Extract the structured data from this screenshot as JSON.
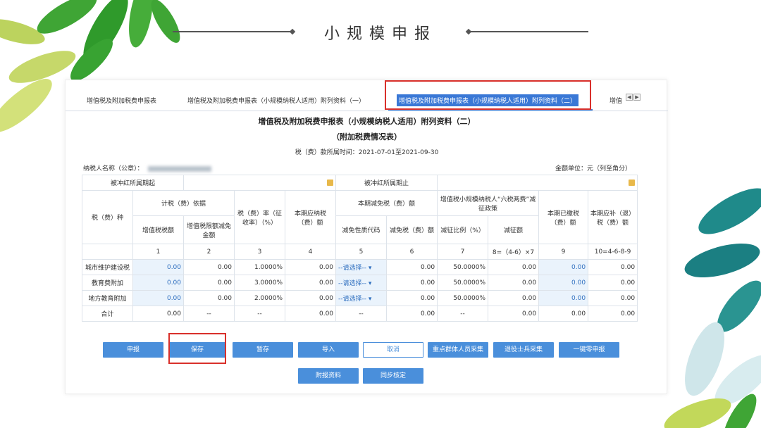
{
  "slide": {
    "title": "小规模申报"
  },
  "tabs": [
    {
      "label": "增值税及附加税费申报表"
    },
    {
      "label": "增值税及附加税费申报表（小规模纳税人适用）附列资料（一）"
    },
    {
      "label": "增值税及附加税费申报表（小规模纳税人适用）附列资料（二）"
    },
    {
      "label": "增值"
    }
  ],
  "form": {
    "title": "增值税及附加税费申报表（小规模纳税人适用）附列资料（二）",
    "subtitle": "（附加税费情况表）",
    "period": "税（费）款所属时间：2021-07-01至2021-09-30",
    "taxpayer_label": "纳税人名称（公章）：",
    "unit": "金额单位：元（列至角分）",
    "offset_start_label": "被冲红所属期起",
    "offset_end_label": "被冲红所属期止"
  },
  "table": {
    "h_tax_type": "税（费）种",
    "h_basis": "计税（费）依据",
    "h_rate": "税（费）率（征收率）（%）",
    "h_payable": "本期应纳税（费）额",
    "h_reduction": "本期减免税（费）额",
    "h_six_taxes": "增值税小规模纳税人“六税两费”减征政策",
    "h_paid": "本期已缴税（费）额",
    "h_due": "本期应补（退）税（费）额",
    "h_vat": "增值税税额",
    "h_vat_limit": "增值税限额减免金额",
    "h_nature_code": "减免性质代码",
    "h_reduction_amt": "减免税（费）额",
    "h_ratio": "减征比例（%）",
    "h_cut_amt": "减征额",
    "col_nums": [
      "1",
      "2",
      "3",
      "4",
      "5",
      "6",
      "7",
      "8=（4-6）×7",
      "9",
      "10=4-6-8-9"
    ],
    "rows": [
      {
        "name": "城市维护建设税",
        "c1": "0.00",
        "c2": "0.00",
        "c3": "1.0000%",
        "c4": "0.00",
        "c5": "--请选择--",
        "c6": "0.00",
        "c7": "50.0000%",
        "c8": "0.00",
        "c9": "0.00",
        "c10": "0.00"
      },
      {
        "name": "教育费附加",
        "c1": "0.00",
        "c2": "0.00",
        "c3": "3.0000%",
        "c4": "0.00",
        "c5": "--请选择--",
        "c6": "0.00",
        "c7": "50.0000%",
        "c8": "0.00",
        "c9": "0.00",
        "c10": "0.00"
      },
      {
        "name": "地方教育附加",
        "c1": "0.00",
        "c2": "0.00",
        "c3": "2.0000%",
        "c4": "0.00",
        "c5": "--请选择--",
        "c6": "0.00",
        "c7": "50.0000%",
        "c8": "0.00",
        "c9": "0.00",
        "c10": "0.00"
      }
    ],
    "total": {
      "name": "合计",
      "c1": "0.00",
      "c2": "--",
      "c3": "--",
      "c4": "0.00",
      "c5": "--",
      "c6": "0.00",
      "c7": "--",
      "c8": "0.00",
      "c9": "0.00",
      "c10": "0.00"
    }
  },
  "buttons": {
    "declare": "申报",
    "save": "保存",
    "temp_save": "暂存",
    "import": "导入",
    "cancel": "取消",
    "key_group": "重点群体人员采集",
    "veterans": "退役士兵采集",
    "zero_declare": "一键零申报",
    "attachments": "附报资料",
    "sync_check": "同步核定"
  },
  "colors": {
    "accent_blue": "#4a8fdb",
    "highlight_red": "#d9302b",
    "leaf_green": "#3fa535"
  }
}
